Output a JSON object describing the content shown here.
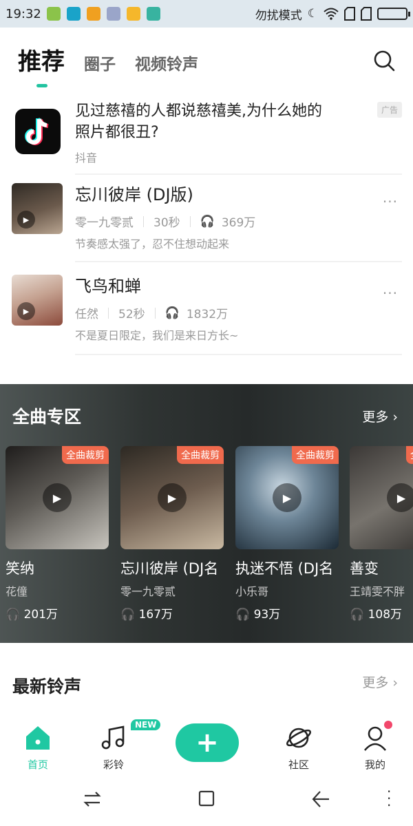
{
  "status": {
    "time": "19:32",
    "mode": "勿扰模式"
  },
  "tabs": {
    "active": "推荐",
    "items": [
      "圈子",
      "视频铃声"
    ]
  },
  "ad": {
    "title": "见过慈禧的人都说慈禧美,为什么她的照片都很丑?",
    "source": "抖音",
    "badge": "广告"
  },
  "songs": [
    {
      "title": "忘川彼岸 (DJ版)",
      "artist": "零一九零贰",
      "duration": "30秒",
      "plays": "369万",
      "desc": "节奏感太强了，忍不住想动起来"
    },
    {
      "title": "飞鸟和蝉",
      "artist": "任然",
      "duration": "52秒",
      "plays": "1832万",
      "desc": "不是夏日限定，我们是来日方长~"
    }
  ],
  "full_section": {
    "title": "全曲专区",
    "more": "更多",
    "cards": [
      {
        "title": "笑纳",
        "artist": "花僮",
        "plays": "201万",
        "tag": "全曲裁剪"
      },
      {
        "title": "忘川彼岸 (DJ名",
        "artist": "零一九零贰",
        "plays": "167万",
        "tag": "全曲裁剪"
      },
      {
        "title": "执迷不悟 (DJ名",
        "artist": "小乐哥",
        "plays": "93万",
        "tag": "全曲裁剪"
      },
      {
        "title": "善变",
        "artist": "王靖雯不胖",
        "plays": "108万",
        "tag": "全曲裁剪"
      }
    ]
  },
  "new_section": {
    "title": "最新铃声",
    "more": "更多"
  },
  "bottom_nav": {
    "home": "首页",
    "ringtone": "彩铃",
    "new_badge": "NEW",
    "community": "社区",
    "mine": "我的"
  },
  "colors": {
    "accent": "#1fc8a2",
    "tag": "#f06a4d",
    "badge_dot": "#f2476b"
  }
}
